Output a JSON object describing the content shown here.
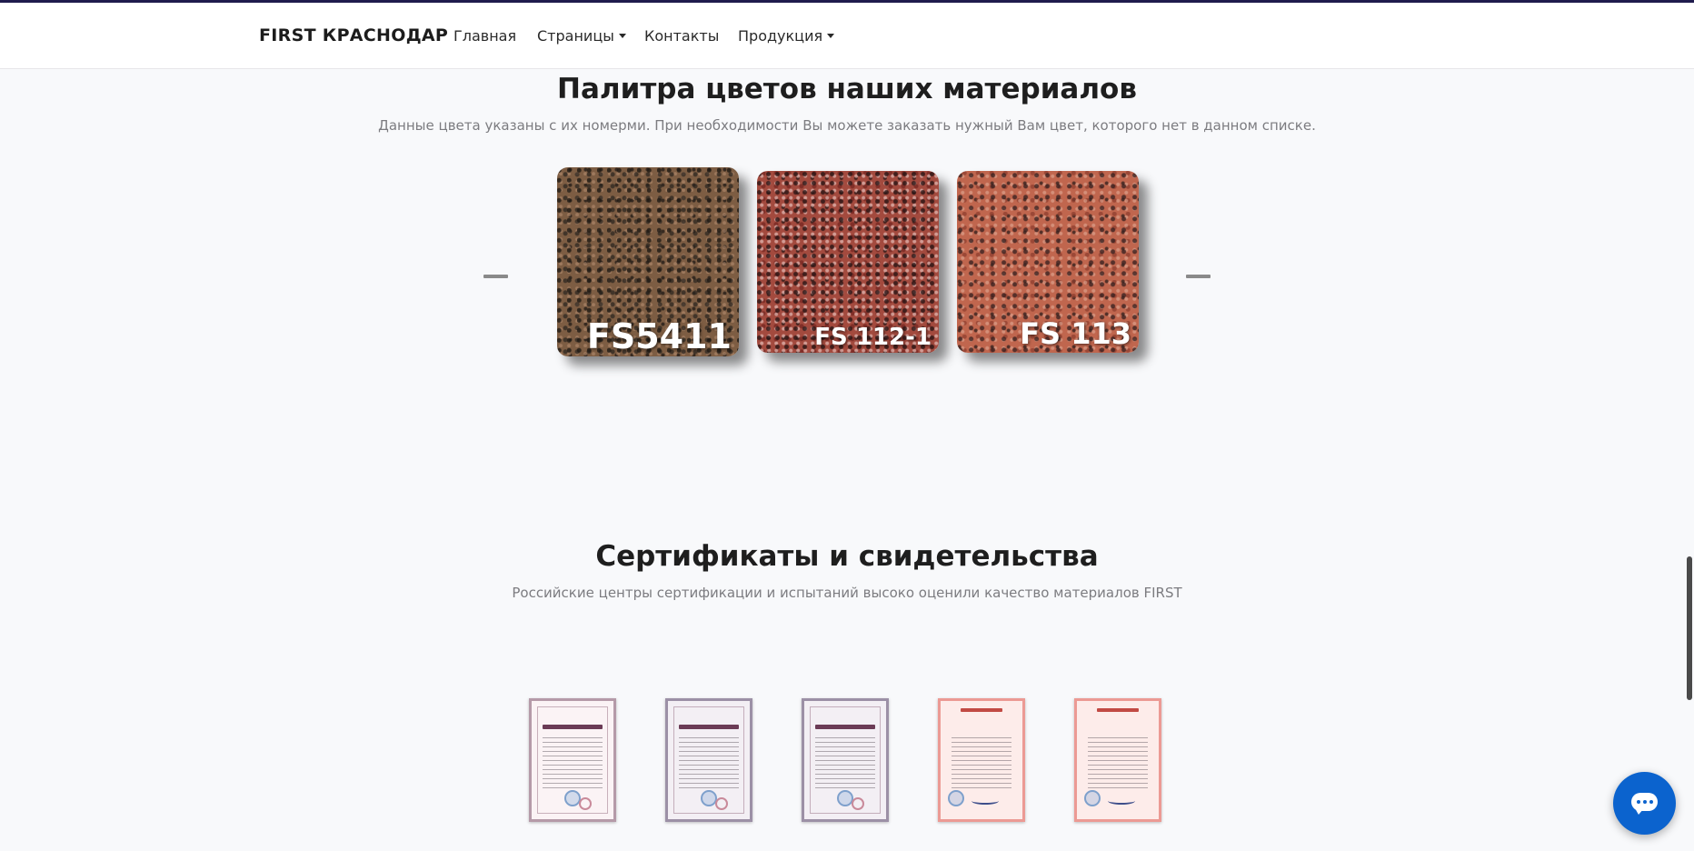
{
  "header": {
    "brand": "FIRST КРАСНОДАР",
    "nav": [
      {
        "label": "Главная"
      },
      {
        "label": "Страницы"
      },
      {
        "label": "Контакты"
      },
      {
        "label": "Продукция"
      }
    ]
  },
  "palette": {
    "title": "Палитра цветов наших материалов",
    "subtitle": "Данные цвета указаны с их номерми. При необходимости Вы можете заказать нужный Вам цвет, которого нет в данном списке.",
    "swatches": [
      {
        "code": "FS5411",
        "color": "#7d5d43"
      },
      {
        "code": "FS 112-1",
        "color": "#a34a3e"
      },
      {
        "code": "FS 113",
        "color": "#c0664e"
      }
    ]
  },
  "certificates": {
    "title": "Сертификаты и свидетельства",
    "subtitle": "Российские центры сертификации и испытаний высоко оценили качество материалов FIRST",
    "items": [
      {
        "kind": "certificate-document"
      },
      {
        "kind": "certificate-document"
      },
      {
        "kind": "certificate-document"
      },
      {
        "kind": "conformity-certificate"
      },
      {
        "kind": "conformity-certificate"
      }
    ]
  },
  "chat": {
    "icon": "chat-bubble-icon",
    "accent": "#0b63ce"
  },
  "colors": {
    "topline": "#1f1b4d",
    "background": "#f8f9fb"
  }
}
